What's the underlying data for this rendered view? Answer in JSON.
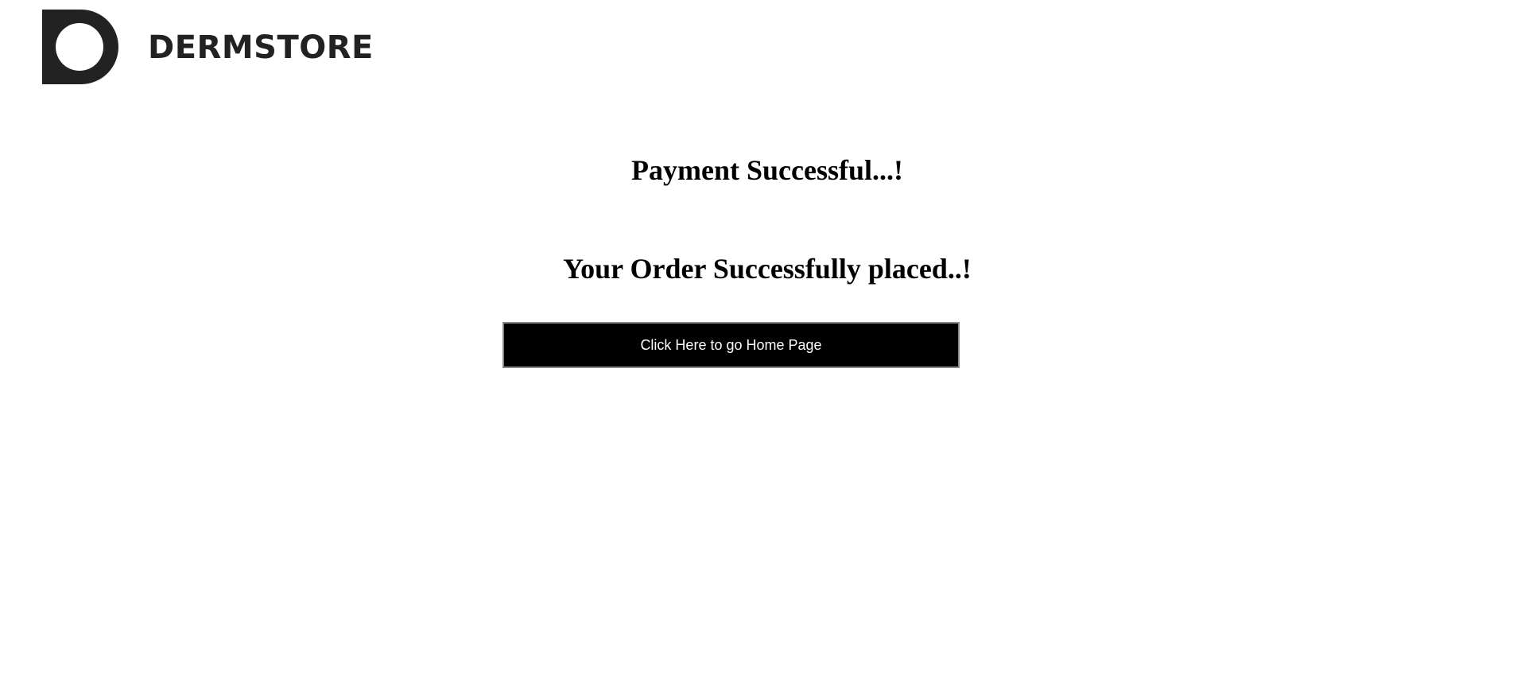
{
  "header": {
    "logo_text": "DERMSTORE",
    "logo_icon": "dermstore-d-logo-icon",
    "brand_color": "#222222"
  },
  "main": {
    "payment_title": "Payment Successful...!",
    "order_message": "Your Order Successfully placed..!",
    "home_button_label": "Click Here to go Home Page"
  }
}
